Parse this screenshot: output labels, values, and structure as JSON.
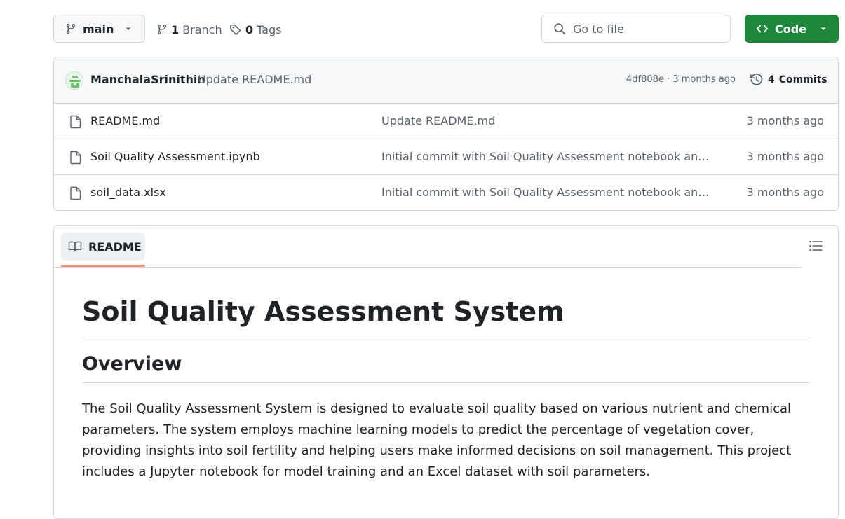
{
  "toolbar": {
    "branch_name": "main",
    "branch_count": "1",
    "branch_label": "Branch",
    "tag_count": "0",
    "tag_label": "Tags",
    "search_placeholder": "Go to file",
    "code_label": "Code"
  },
  "latest_commit": {
    "author": "ManchalaSrinithin",
    "message": "Update README.md",
    "meta": "4df808e · 3 months ago",
    "commits_count": "4",
    "commits_label": "Commits"
  },
  "files": [
    {
      "name": "README.md",
      "message": "Update README.md",
      "time": "3 months ago",
      "icon": "file-icon"
    },
    {
      "name": "Soil Quality Assessment.ipynb",
      "message": "Initial commit with Soil Quality Assessment notebook and d...",
      "time": "3 months ago",
      "icon": "file-icon"
    },
    {
      "name": "soil_data.xlsx",
      "message": "Initial commit with Soil Quality Assessment notebook and d...",
      "time": "3 months ago",
      "icon": "file-icon"
    }
  ],
  "readme": {
    "tab_label": "README",
    "title": "Soil Quality Assessment System",
    "overview_heading": "Overview",
    "overview_text": "The Soil Quality Assessment System is designed to evaluate soil quality based on various nutrient and chemical parameters. The system employs machine learning models to predict the percentage of vegetation cover, providing insights into soil fertility and helping users make informed decisions on soil management. This project includes a Jupyter notebook for model training and an Excel dataset with soil parameters."
  },
  "colors": {
    "code_button": "#1f883d",
    "tab_underline": "#fd8c73",
    "border": "#d1d9e0",
    "muted_text": "#59636e"
  }
}
